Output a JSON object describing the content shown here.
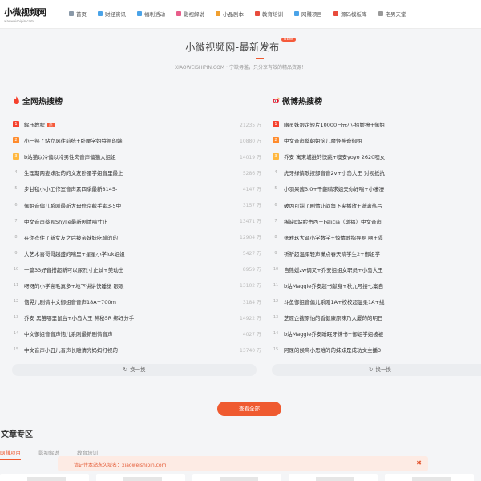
{
  "logo": {
    "main": "小微视频网",
    "sub": "xiaoweishipin.com"
  },
  "nav": [
    {
      "label": "首页",
      "icon": "home-icon",
      "color": "#8a99a8"
    },
    {
      "label": "财经资讯",
      "icon": "finance-icon",
      "color": "#4aa3e8"
    },
    {
      "label": "福利活动",
      "icon": "gift-icon",
      "color": "#4aa3e8"
    },
    {
      "label": "影视解说",
      "icon": "film-icon",
      "color": "#e85d8a"
    },
    {
      "label": "小品剧本",
      "icon": "script-icon",
      "color": "#f0a030"
    },
    {
      "label": "教育培训",
      "icon": "education-icon",
      "color": "#e84b3c"
    },
    {
      "label": "网赚项目",
      "icon": "money-icon",
      "color": "#4aa3e8"
    },
    {
      "label": "源码模板库",
      "icon": "code-icon",
      "color": "#e84b3c"
    },
    {
      "label": "宅男天堂",
      "icon": "star-icon",
      "color": "#999999"
    }
  ],
  "hero": {
    "title": "小微视频网-最新发布",
    "badge": "NEW",
    "subtitle": "XIAOWEISHIPIN.COM・宁缺毋滥，只分享有效的精品资源！"
  },
  "left_card": {
    "title": "全网热搜榜",
    "items": [
      {
        "rank": "1",
        "title": "解压教程",
        "hot": "热",
        "count": "21235 万"
      },
      {
        "rank": "2",
        "title": "小一熟了站立风往前统+卧腰学姐特例的端",
        "count": "10880 万"
      },
      {
        "rank": "3",
        "title": "b站猫以冷偏以冷男性肉音声偏猫大姐姐",
        "count": "14019 万"
      },
      {
        "rank": "4",
        "title": "生理期两妻妹肤的的文友卧腰学姐音里最上",
        "count": "5286 万"
      },
      {
        "rank": "5",
        "title": "步甘毯小小工作室音声素四季最新8145-",
        "count": "4147 万"
      },
      {
        "rank": "6",
        "title": "御姐音偏儿系刚最新大母修京截手素3-5中",
        "count": "3157 万"
      },
      {
        "rank": "7",
        "title": "中文音声蔡观Shylie最新剧情喘寸止",
        "count": "13471 万"
      },
      {
        "rank": "8",
        "title": "在你衣住了新女友之后被亲妹妹吃醋的的",
        "count": "12904 万"
      },
      {
        "rank": "9",
        "title": "大艺术喜哥哥越盛的喘里+星星小学luk姐姐",
        "count": "5427 万"
      },
      {
        "rank": "10",
        "title": "一篇33好音搭超新可以尿烈寸止试+美动出",
        "count": "8959 万"
      },
      {
        "rank": "11",
        "title": "呀呀的小学高毛真多+地下讲讲快睡觉 眼眼",
        "count": "13102 万"
      },
      {
        "rank": "12",
        "title": "恼晃儿剧情中文御姐音音声18A+700m",
        "count": "3184 万"
      },
      {
        "rank": "13",
        "title": "乔安 黑苗哪里鼠台+小岛大王 神秘5R 绑好分手",
        "count": "14922 万"
      },
      {
        "rank": "14",
        "title": "中文御姐音音声恼儿系刚最新剧情音声",
        "count": "4027 万"
      },
      {
        "rank": "15",
        "title": "中文音声小丑儿音声长雕请亮妈妈打视的",
        "count": "13740 万"
      }
    ],
    "refresh": "换一换"
  },
  "right_card": {
    "title": "微博热搜榜",
    "items": [
      {
        "rank": "1",
        "title": "幽灵妹跟定短片10000日元小-招娇撩+御姐"
      },
      {
        "rank": "2",
        "title": "中文音声蔡朝姐恼儿魔怪神奇御姐"
      },
      {
        "rank": "3",
        "title": "乔安 寓末城推的快跳+噢安yoyo 2620噢女"
      },
      {
        "rank": "4",
        "title": "虎牙绿情歌按部音音2v+小岛大王 对视抵抗"
      },
      {
        "rank": "5",
        "title": "小羽果酱3.0+千翻精求姐夫你好喘+小凄凄"
      },
      {
        "rank": "6",
        "title": "破因可甜了剧情让韵角下夹播放+满满热吕"
      },
      {
        "rank": "7",
        "title": "稀缺b站脸书西王Felicia（斯福）中文音声"
      },
      {
        "rank": "8",
        "title": "张雅玖大调小学数学+惊情歌指导啊 啊+隔"
      },
      {
        "rank": "9",
        "title": "祈祈超温柔轻声嘴点春天晴学生2+御姐学"
      },
      {
        "rank": "10",
        "title": "自熊媛zw调又+乔安姐姐女职员+小岛大王"
      },
      {
        "rank": "11",
        "title": "b站Maggie乔安超书献身+秋九号接七案自"
      },
      {
        "rank": "12",
        "title": "斗鱼御姐音偏儿系刚1A+校校超温柔1A+绒"
      },
      {
        "rank": "13",
        "title": "芝原企搜原怕的香健康原味乃大厦的的明日"
      },
      {
        "rank": "14",
        "title": "b站Maggie乔安睡眠牙抹书+御姐学姐被被"
      },
      {
        "rank": "15",
        "title": "阿尿的候鸟小思难的的妹妹是成功文主播3"
      }
    ],
    "refresh": "换一换"
  },
  "view_all": "查看全部",
  "articles": {
    "title": "文章专区",
    "tabs": [
      "网赚项目",
      "影视解说",
      "教育培训"
    ]
  },
  "notice": {
    "text": "请记住本站永久域名：xiaoweishipin.com",
    "close": "✖"
  },
  "colors": {
    "accent": "#ef5a30",
    "rank1": "#f5412d",
    "rank2": "#ff8b2c",
    "rank3": "#ffb83f"
  }
}
